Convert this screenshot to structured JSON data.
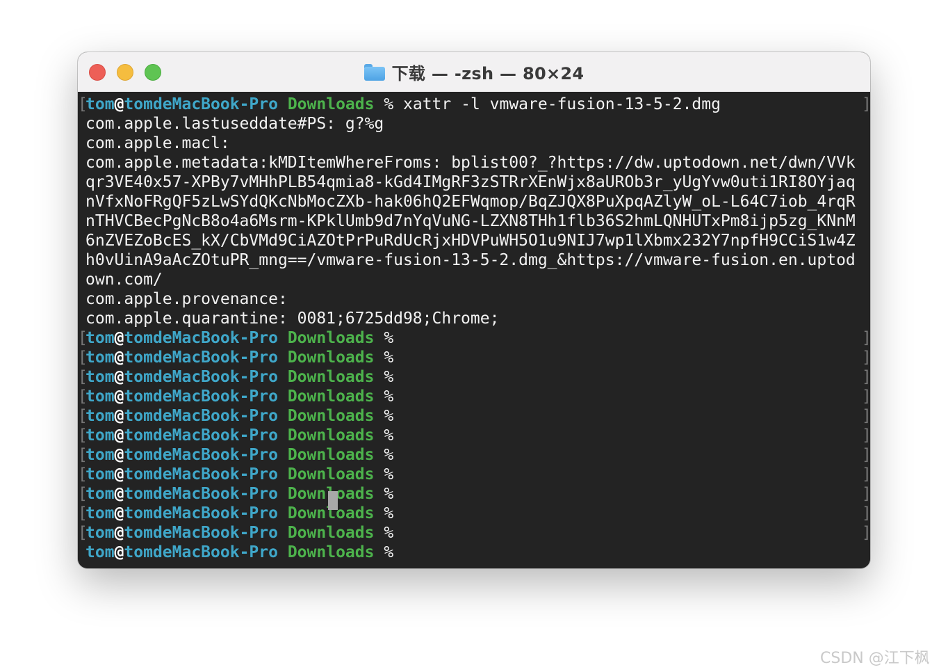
{
  "window": {
    "title": "下载 — -zsh — 80×24",
    "title_icon": "folder-icon",
    "traffic_lights": {
      "close_color": "#ed5f57",
      "minimize_color": "#f5bd3f",
      "zoom_color": "#5fc453"
    }
  },
  "prompt": {
    "user": "tom",
    "at": "@",
    "host": "tomdeMacBook-Pro",
    "dir": "Downloads",
    "symbol": "%"
  },
  "colors": {
    "background": "#232323",
    "user_host": "#3fa7c9",
    "directory": "#4db34c",
    "text": "#f2f2f2"
  },
  "command": " xattr -l vmware-fusion-13-5-2.dmg",
  "output": [
    "com.apple.lastuseddate#PS: g?%g",
    "com.apple.macl:",
    "com.apple.metadata:kMDItemWhereFroms: bplist00?_?https://dw.uptodown.net/dwn/VVk",
    "qr3VE40x57-XPBy7vMHhPLB54qmia8-kGd4IMgRF3zSTRrXEnWjx8aUROb3r_yUgYvw0uti1RI8OYjaq",
    "nVfxNoFRgQF5zLwSYdQKcNbMocZXb-hak06hQ2EFWqmop/BqZJQX8PuXpqAZlyW_oL-L64C7iob_4rqR",
    "nTHVCBecPgNcB8o4a6Msrm-KPklUmb9d7nYqVuNG-LZXN8THh1flb36S2hmLQNHUTxPm8ijp5zg_KNnM",
    "6nZVEZoBcES_kX/CbVMd9CiAZOtPrPuRdUcRjxHDVPuWH5O1u9NIJ7wp1lXbmx232Y7npfH9CCiS1w4Z",
    "h0vUinA9aAcZOtuPR_mng==/vmware-fusion-13-5-2.dmg_&https://vmware-fusion.en.uptod",
    "own.com/",
    "com.apple.provenance:",
    "com.apple.quarantine: 0081;6725dd98;Chrome;"
  ],
  "watermark": "CSDN @江下枫"
}
